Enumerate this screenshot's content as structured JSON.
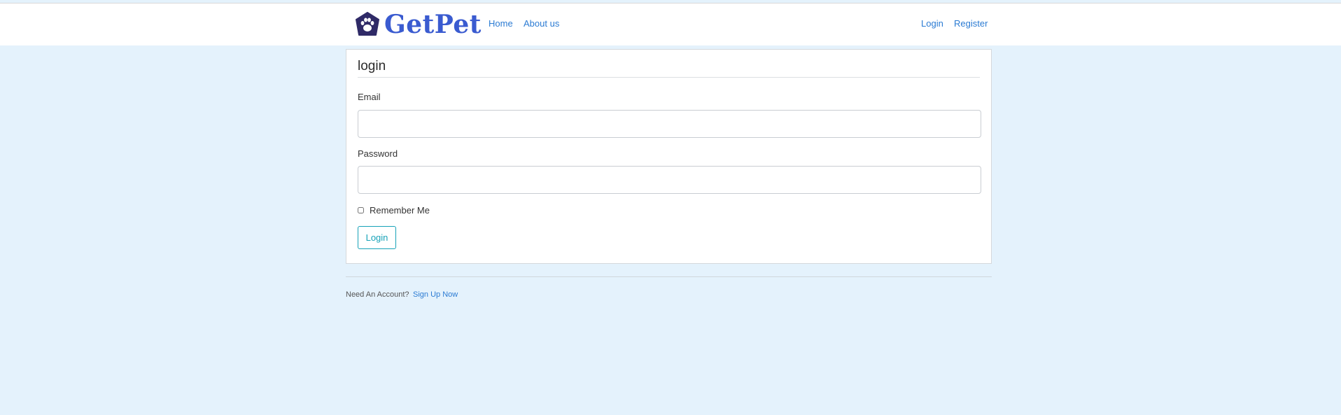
{
  "brand": {
    "name": "GetPet",
    "logo_icon": "paw-icon",
    "color": "#3a5bd0"
  },
  "nav": {
    "home_label": "Home",
    "about_label": "About us",
    "login_label": "Login",
    "register_label": "Register"
  },
  "form": {
    "title": "login",
    "email_label": "Email",
    "email_value": "",
    "password_label": "Password",
    "password_value": "",
    "remember_label": "Remember Me",
    "remember_checked": false,
    "submit_label": "Login"
  },
  "footer": {
    "prompt": "Need An Account?",
    "signup_label": "Sign Up Now"
  },
  "colors": {
    "page_background": "#e4f2fc",
    "link": "#2b7bd3",
    "button_outline": "#17a2b8"
  }
}
